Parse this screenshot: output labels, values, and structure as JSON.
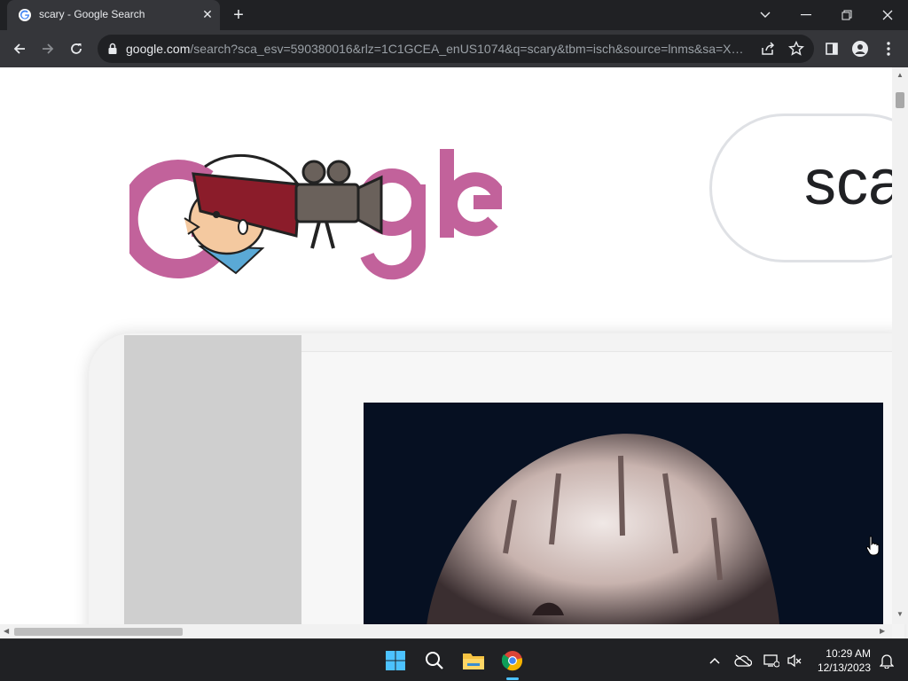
{
  "browser": {
    "tab": {
      "title": "scary - Google Search",
      "favicon": "google-g-icon"
    },
    "url": {
      "host": "google.com",
      "path": "/search?sca_esv=590380016&rlz=1C1GCEA_enUS1074&q=scary&tbm=isch&source=lnms&sa=X&v..."
    }
  },
  "search": {
    "query_visible": "sca"
  },
  "taskbar": {
    "time": "10:29 AM",
    "date": "12/13/2023"
  },
  "colors": {
    "doodle_pink": "#c2629b",
    "browser_dark": "#202124",
    "toolbar": "#35363a"
  }
}
